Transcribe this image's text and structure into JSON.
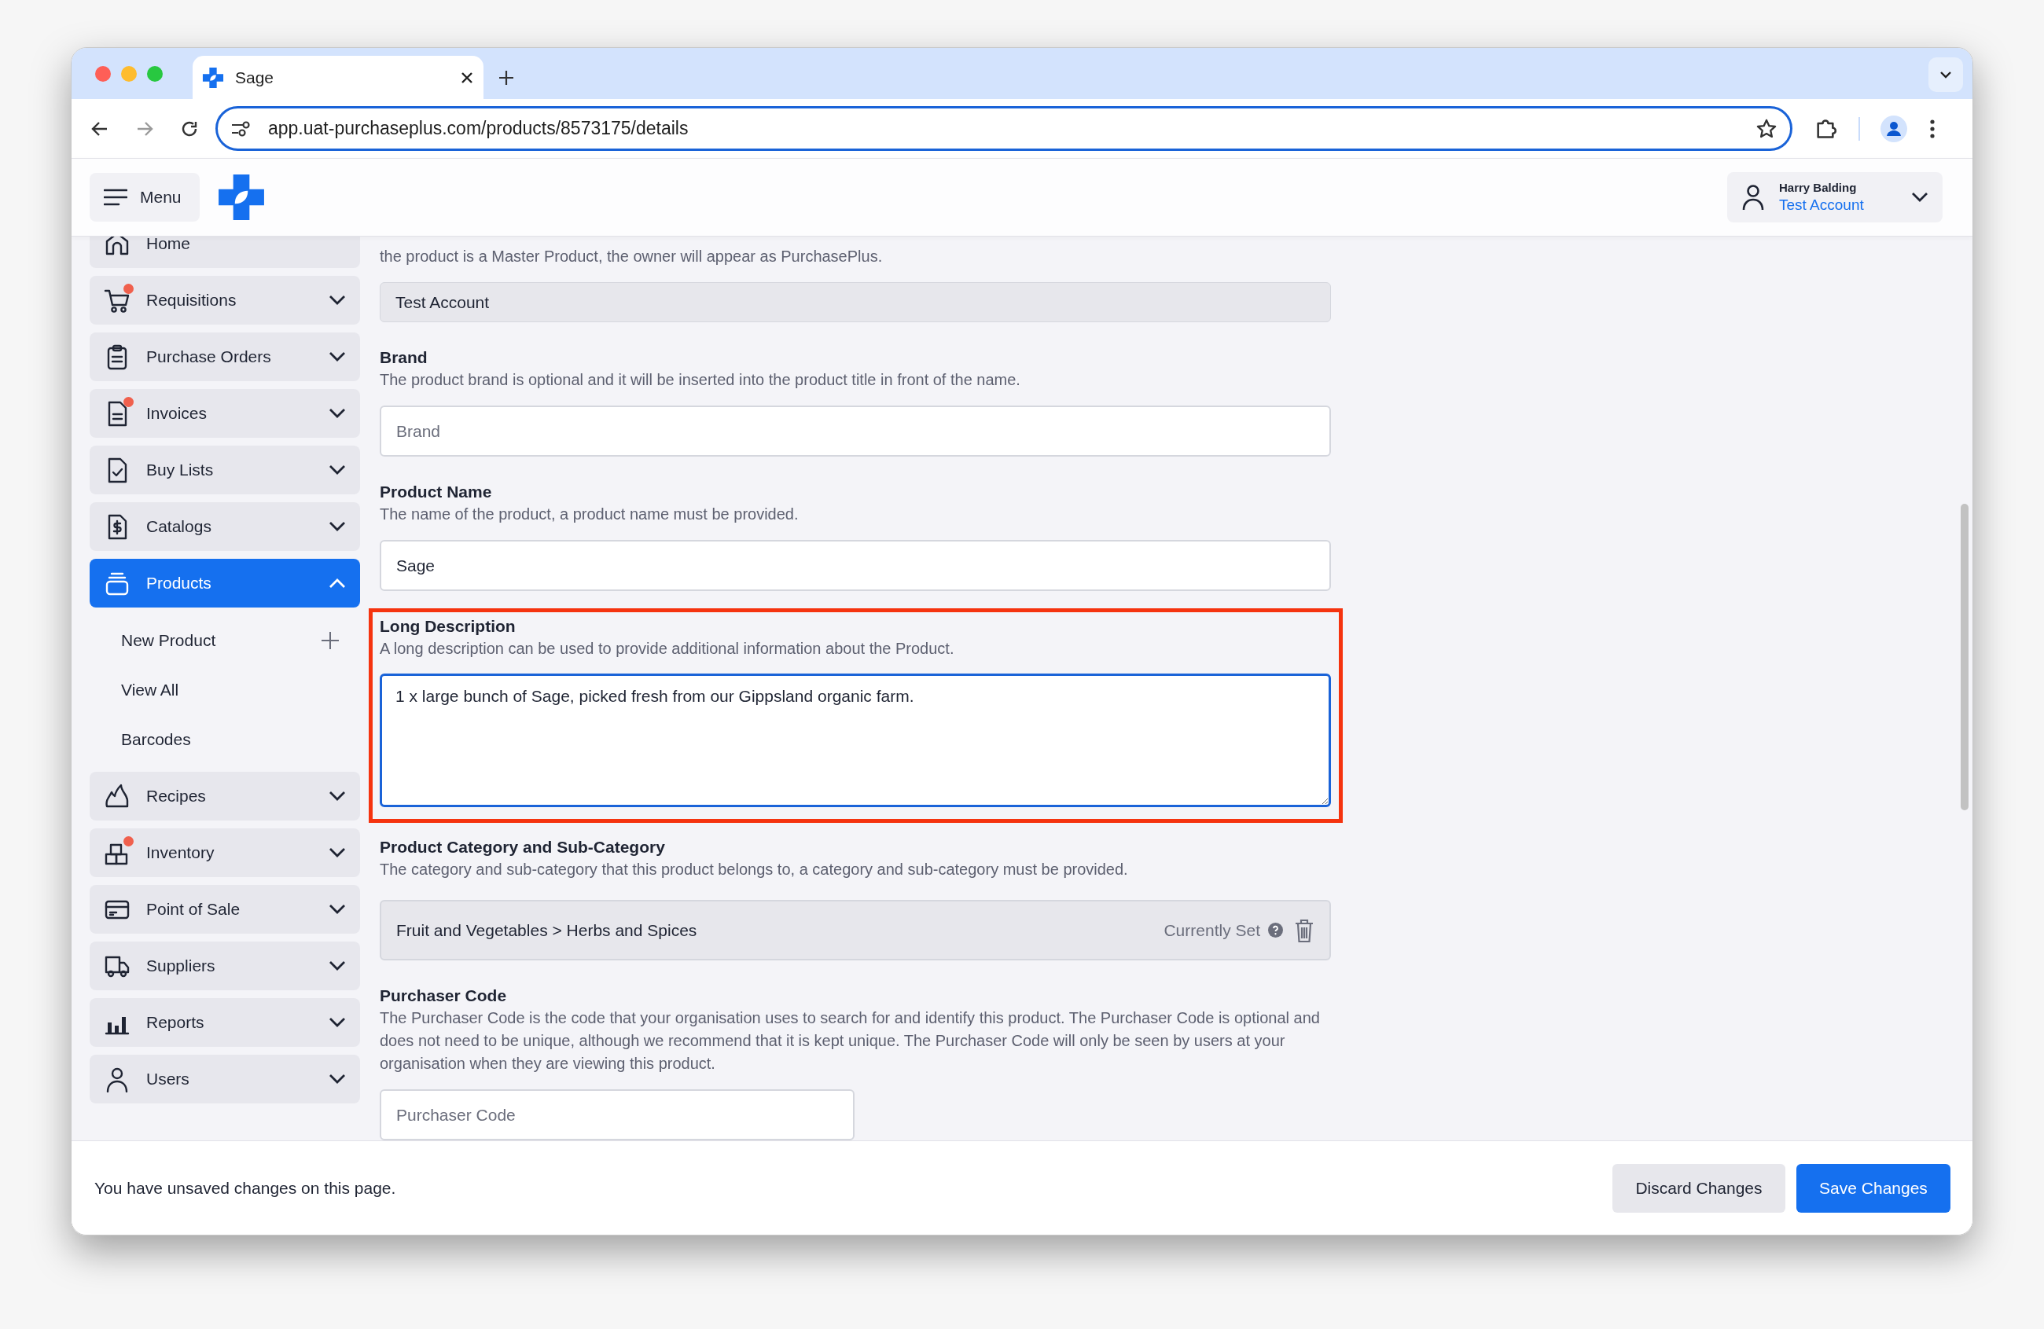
{
  "browser": {
    "tab_title": "Sage",
    "url": "app.uat-purchaseplus.com/products/8573175/details"
  },
  "app_header": {
    "menu_label": "Menu",
    "user": {
      "name": "Harry Balding",
      "account": "Test Account"
    }
  },
  "sidebar": {
    "items": [
      {
        "label": "Home",
        "kind": "link",
        "badge": false,
        "selected": false
      },
      {
        "label": "Requisitions",
        "kind": "group",
        "badge": true,
        "selected": false,
        "expanded": false
      },
      {
        "label": "Purchase Orders",
        "kind": "group",
        "badge": false,
        "selected": false,
        "expanded": false
      },
      {
        "label": "Invoices",
        "kind": "group",
        "badge": true,
        "selected": false,
        "expanded": false
      },
      {
        "label": "Buy Lists",
        "kind": "group",
        "badge": false,
        "selected": false,
        "expanded": false
      },
      {
        "label": "Catalogs",
        "kind": "group",
        "badge": false,
        "selected": false,
        "expanded": false
      },
      {
        "label": "Products",
        "kind": "group",
        "badge": false,
        "selected": true,
        "expanded": true,
        "children": [
          {
            "label": "New Product",
            "kind": "create"
          },
          {
            "label": "View All",
            "kind": "link"
          },
          {
            "label": "Barcodes",
            "kind": "link"
          }
        ]
      },
      {
        "label": "Recipes",
        "kind": "group",
        "badge": false,
        "selected": false,
        "expanded": false
      },
      {
        "label": "Inventory",
        "kind": "group",
        "badge": true,
        "selected": false,
        "expanded": false
      },
      {
        "label": "Point of Sale",
        "kind": "group",
        "badge": false,
        "selected": false,
        "expanded": false
      },
      {
        "label": "Suppliers",
        "kind": "group",
        "badge": false,
        "selected": false,
        "expanded": false
      },
      {
        "label": "Reports",
        "kind": "group",
        "badge": false,
        "selected": false,
        "expanded": false
      },
      {
        "label": "Users",
        "kind": "group",
        "badge": false,
        "selected": false,
        "expanded": false
      }
    ]
  },
  "form": {
    "owner_note": "the product is a Master Product, the owner will appear as PurchasePlus.",
    "owner_value": "Test Account",
    "fields": [
      {
        "kind": "text",
        "label": "Brand",
        "description": "The product brand is optional and it will be inserted into the product title in front of the name.",
        "placeholder": "Brand"
      },
      {
        "kind": "text",
        "label": "Product Name",
        "description": "The name of the product, a product name must be provided.",
        "value": "Sage"
      },
      {
        "kind": "textarea",
        "label": "Long Description",
        "description": "A long description can be used to provide additional information about the Product.",
        "value": "1 x large bunch of Sage, picked fresh from our Gippsland organic farm.",
        "focused": true,
        "highlighted": true
      },
      {
        "kind": "category",
        "label": "Product Category and Sub-Category",
        "description": "The category and sub-category that this product belongs to, a category and sub-category must be provided.",
        "value": "Fruit and Vegetables > Herbs and Spices",
        "status": "Currently Set"
      },
      {
        "kind": "text_short",
        "label": "Purchaser Code",
        "description": "The Purchaser Code is the code that your organisation uses to search for and identify this product. The Purchaser Code is optional and does not need to be unique, although we recommend that it is kept unique. The Purchaser Code will only be seen by users at your organisation when they are viewing this product.",
        "placeholder": "Purchaser Code"
      }
    ]
  },
  "footer": {
    "message": "You have unsaved changes on this page.",
    "buttons": [
      {
        "label": "Discard Changes",
        "kind": "secondary"
      },
      {
        "label": "Save Changes",
        "kind": "primary"
      }
    ]
  }
}
